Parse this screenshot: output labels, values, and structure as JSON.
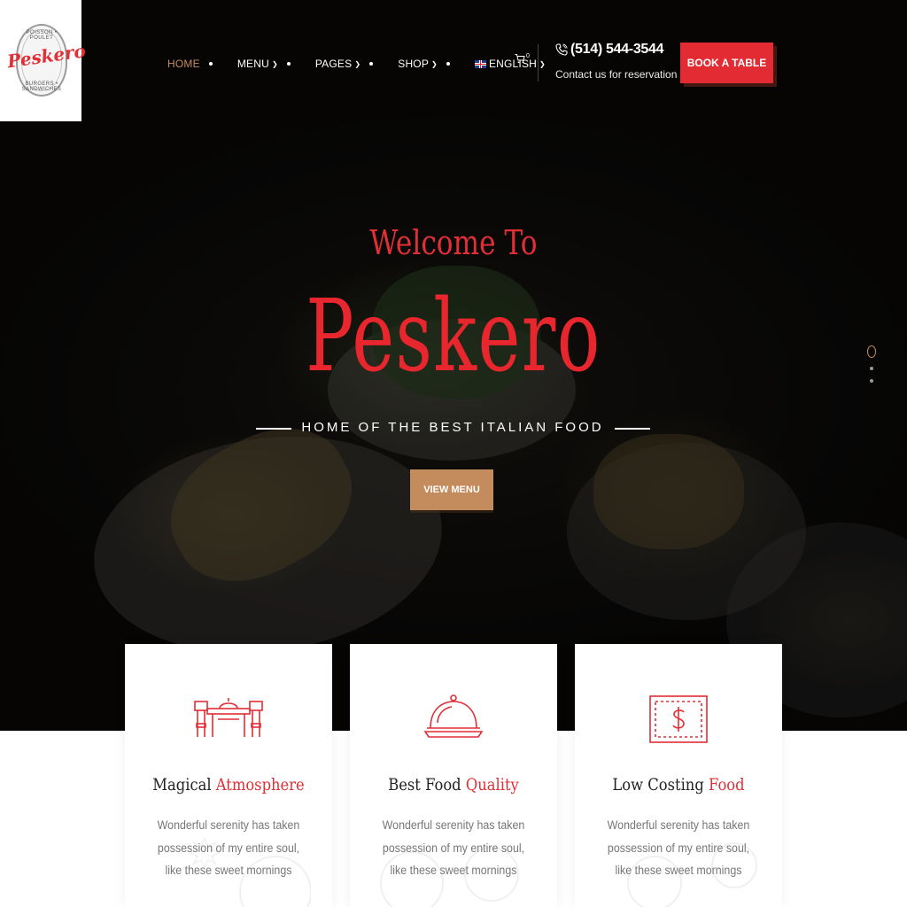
{
  "logo": {
    "name": "Peskero",
    "top_text": "POISSON • POULET",
    "bottom_text": "BURGERS • SANDWICHES"
  },
  "nav": {
    "items": [
      {
        "label": "HOME",
        "active": true
      },
      {
        "label": "MENU",
        "dropdown": true
      },
      {
        "label": "PAGES",
        "dropdown": true
      },
      {
        "label": "SHOP",
        "dropdown": true
      },
      {
        "label": "ENGLISH",
        "dropdown": true,
        "flag": "uk-flag-icon"
      }
    ],
    "cart_count": "0"
  },
  "contact": {
    "phone": "(514) 544-3544",
    "subtitle": "Contact us for reservation"
  },
  "book_button": "BOOK A TABLE",
  "hero": {
    "welcome": "Welcome To",
    "brand": "Peskero",
    "tagline": "HOME OF THE BEST ITALIAN FOOD",
    "button": "VIEW MENU"
  },
  "features": [
    {
      "title_plain": "Magical ",
      "title_highlight": "Atmosphere",
      "text": "Wonderful serenity has taken possession of my entire soul, like these sweet mornings",
      "icon": "dining-table-icon"
    },
    {
      "title_plain": "Best Food ",
      "title_highlight": "Quality",
      "text": "Wonderful serenity has taken possession of my entire soul, like these sweet mornings",
      "icon": "cloche-icon"
    },
    {
      "title_plain": "Low Costing ",
      "title_highlight": "Food",
      "text": "Wonderful serenity has taken possession of my entire soul, like these sweet mornings",
      "icon": "dollar-bill-icon"
    }
  ],
  "colors": {
    "brand_red": "#e12f36",
    "accent_tan": "#c48c5d",
    "button_red": "#e32b33"
  }
}
